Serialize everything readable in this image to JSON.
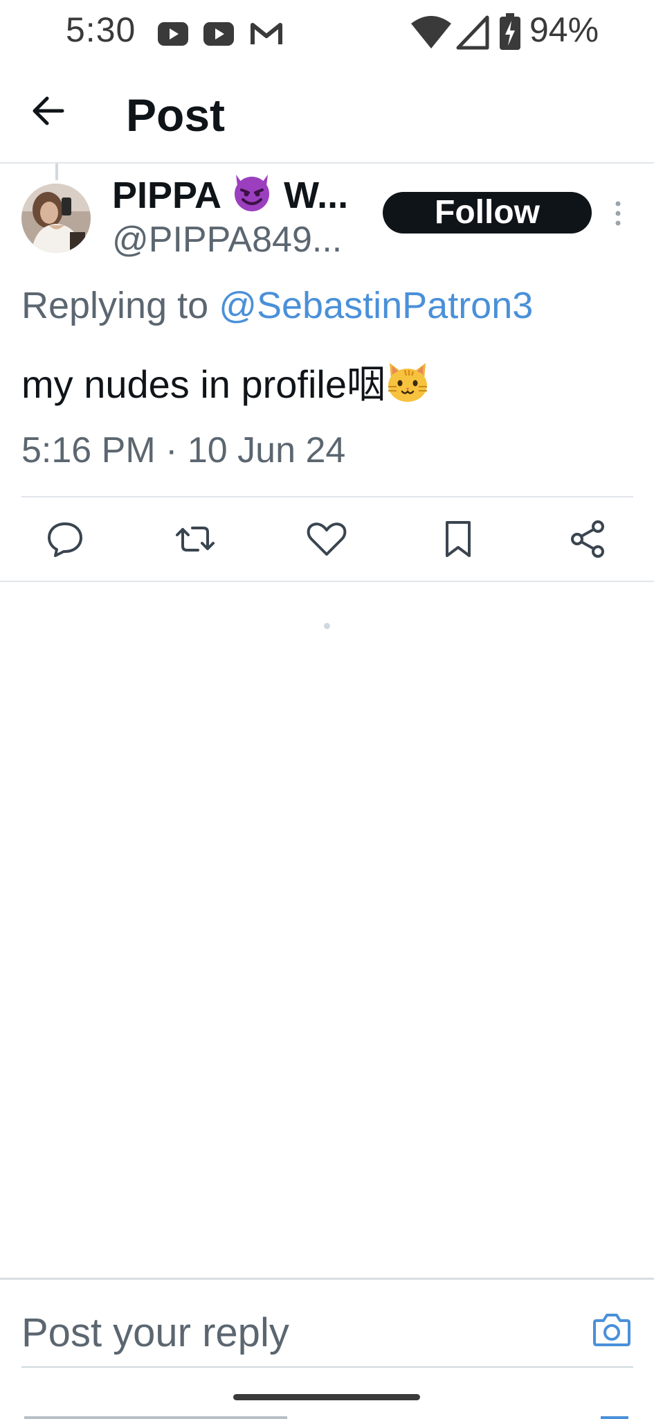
{
  "status_bar": {
    "time": "5:30",
    "battery": "94%",
    "icons": [
      "youtube-icon",
      "youtube-icon",
      "gmail-icon",
      "wifi-icon",
      "cell-signal-icon",
      "battery-charging-icon"
    ]
  },
  "header": {
    "back_icon": "arrow-left-icon",
    "title": "Post"
  },
  "post": {
    "author_name": "PIPPA",
    "author_name_suffix": "W...",
    "author_emoji": "smiling-devil-emoji",
    "handle": "@PIPPA849...",
    "follow_label": "Follow",
    "replying_prefix": "Replying to",
    "replying_to": "@SebastinPatron3",
    "text": "my nudes in profile咽",
    "text_emoji": "cat-face-emoji",
    "timestamp": "5:16 PM · 10 Jun 24"
  },
  "actions": [
    "reply-icon",
    "repost-icon",
    "like-icon",
    "bookmark-icon",
    "share-icon"
  ],
  "reply_bar": {
    "placeholder": "Post your reply",
    "camera_icon": "camera-icon"
  },
  "colors": {
    "text_primary": "#0f1419",
    "text_secondary": "#5b6670",
    "link": "#4a90d9",
    "follow_bg": "#0f1419",
    "divider": "#e1e6ea"
  }
}
